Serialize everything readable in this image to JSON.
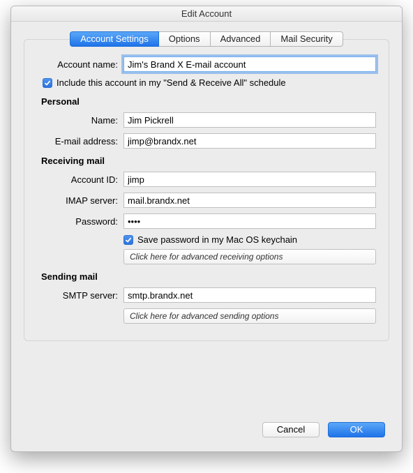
{
  "window": {
    "title": "Edit Account"
  },
  "tabs": {
    "account_settings": "Account Settings",
    "options": "Options",
    "advanced": "Advanced",
    "mail_security": "Mail Security"
  },
  "account": {
    "name_label": "Account name:",
    "name_value": "Jim's Brand X E-mail account",
    "include_schedule_label": "Include this account in my \"Send & Receive All\" schedule"
  },
  "personal": {
    "header": "Personal",
    "name_label": "Name:",
    "name_value": "Jim Pickrell",
    "email_label": "E-mail address:",
    "email_value": "jimp@brandx.net"
  },
  "receiving": {
    "header": "Receiving mail",
    "account_id_label": "Account ID:",
    "account_id_value": "jimp",
    "imap_label": "IMAP server:",
    "imap_value": "mail.brandx.net",
    "password_label": "Password:",
    "password_value": "••••",
    "save_pw_label": "Save password in my Mac OS keychain",
    "advanced_btn": "Click here for advanced receiving options"
  },
  "sending": {
    "header": "Sending mail",
    "smtp_label": "SMTP server:",
    "smtp_value": "smtp.brandx.net",
    "advanced_btn": "Click here for advanced sending options"
  },
  "footer": {
    "cancel": "Cancel",
    "ok": "OK"
  }
}
